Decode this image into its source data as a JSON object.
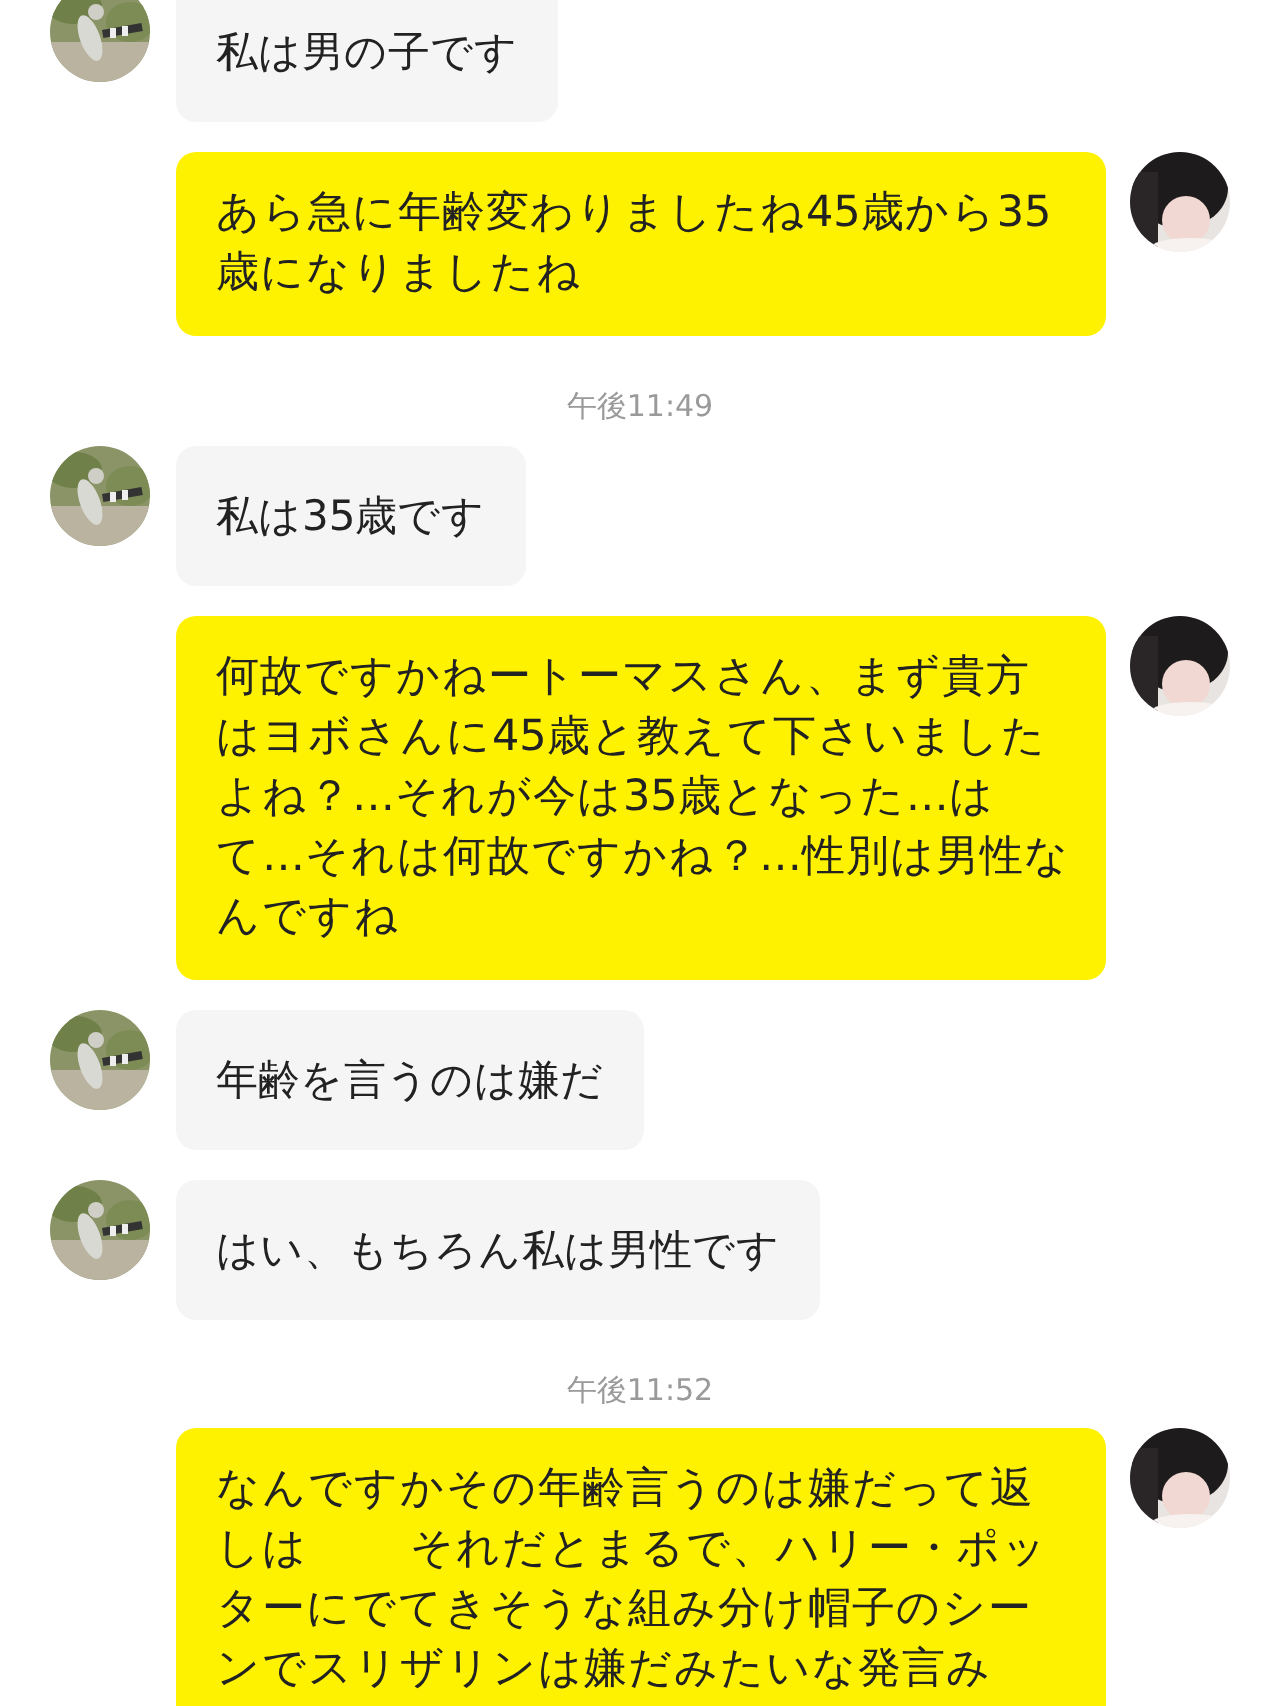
{
  "messages": [
    {
      "kind": "incoming",
      "text": "私は男の子です"
    },
    {
      "kind": "outgoing",
      "text": "あら急に年齢変わりましたね45歳から35歳になりましたね"
    },
    {
      "kind": "time",
      "text": "午後11:49"
    },
    {
      "kind": "incoming",
      "text": "私は35歳です"
    },
    {
      "kind": "outgoing",
      "text": "何故ですかねートーマスさん、まず貴方はヨボさんに45歳と教えて下さいましたよね？…それが今は35歳となった…はて…それは何故ですかね？…性別は男性なんですね"
    },
    {
      "kind": "incoming",
      "text": "年齢を言うのは嫌だ"
    },
    {
      "kind": "incoming",
      "text": "はい、もちろん私は男性です"
    },
    {
      "kind": "time",
      "text": "午後11:52"
    },
    {
      "kind": "outgoing",
      "text": "なんですかその年齢言うのは嫌だって返しは　　  それだとまるで、ハリー・ポッターにでてきそうな組み分け帽子のシーンでスリザリンは嫌だみたいな発言み"
    }
  ]
}
